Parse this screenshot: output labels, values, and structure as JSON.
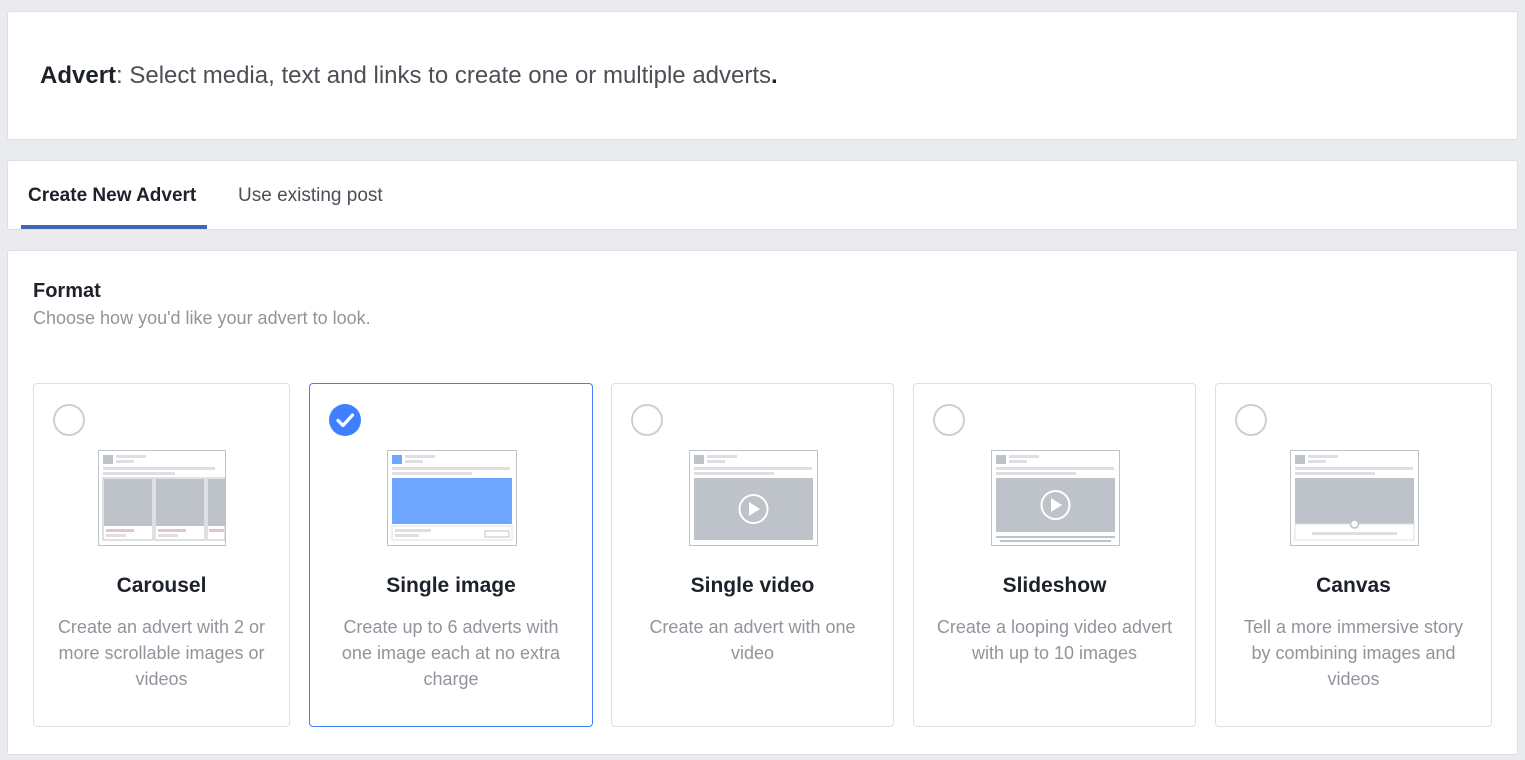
{
  "header": {
    "title_bold": "Advert",
    "title_rest": ": Select media, text and links to create one or multiple adverts",
    "title_period": "."
  },
  "tabs": [
    {
      "label": "Create New Advert",
      "active": true
    },
    {
      "label": "Use existing post",
      "active": false
    }
  ],
  "format": {
    "title": "Format",
    "subtitle": "Choose how you'd like your advert to look."
  },
  "cards": [
    {
      "title": "Carousel",
      "description": "Create an advert with 2 or more scrollable images or videos",
      "selected": false,
      "icon": "carousel-preview-icon"
    },
    {
      "title": "Single image",
      "description": "Create up to 6 adverts with one image each at no extra charge",
      "selected": true,
      "icon": "single-image-preview-icon"
    },
    {
      "title": "Single video",
      "description": "Create an advert with one video",
      "selected": false,
      "icon": "single-video-preview-icon"
    },
    {
      "title": "Slideshow",
      "description": "Create a looping video advert with up to 10 images",
      "selected": false,
      "icon": "slideshow-preview-icon"
    },
    {
      "title": "Canvas",
      "description": "Tell a more immersive story by combining images and videos",
      "selected": false,
      "icon": "canvas-preview-icon"
    }
  ],
  "colors": {
    "accent": "#4080ff",
    "tab_underline": "#4267b2",
    "placeholder_gray": "#bec3c9",
    "selected_image_fill": "#6ea6ff"
  }
}
